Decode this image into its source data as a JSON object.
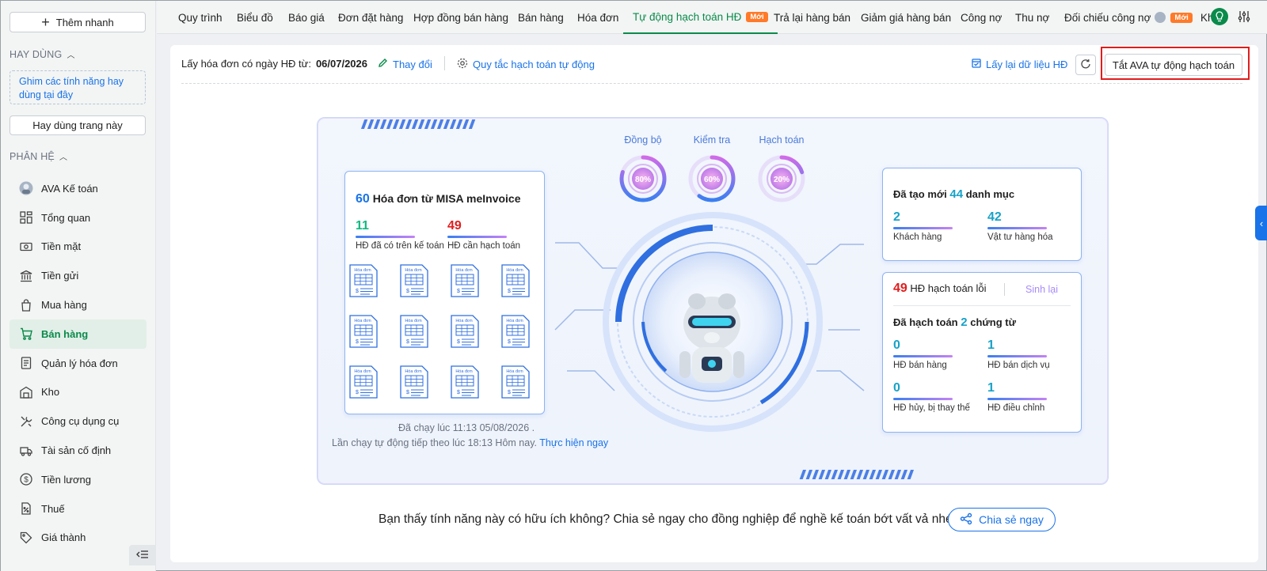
{
  "sidebar": {
    "quick_add": "Thêm nhanh",
    "favorites_title": "HAY DÙNG",
    "pin_hint": "Ghim các tính năng hay dùng tại đây",
    "fav_button": "Hay dùng trang này",
    "modules_title": "PHÂN HỆ",
    "items": [
      {
        "label": "AVA Kế toán",
        "icon": "ava-avatar-icon"
      },
      {
        "label": "Tổng quan",
        "icon": "dashboard-icon"
      },
      {
        "label": "Tiền mặt",
        "icon": "cash-icon"
      },
      {
        "label": "Tiền gửi",
        "icon": "bank-icon"
      },
      {
        "label": "Mua hàng",
        "icon": "shopping-bag-icon"
      },
      {
        "label": "Bán hàng",
        "icon": "cart-icon"
      },
      {
        "label": "Quản lý hóa đơn",
        "icon": "invoice-icon"
      },
      {
        "label": "Kho",
        "icon": "warehouse-icon"
      },
      {
        "label": "Công cụ dụng cụ",
        "icon": "tools-icon"
      },
      {
        "label": "Tài sản cố định",
        "icon": "truck-icon"
      },
      {
        "label": "Tiền lương",
        "icon": "dollar-circle-icon"
      },
      {
        "label": "Thuế",
        "icon": "tax-icon"
      },
      {
        "label": "Giá thành",
        "icon": "price-tag-icon"
      }
    ],
    "active_item": "Bán hàng"
  },
  "tabs": [
    {
      "label": "Quy trình"
    },
    {
      "label": "Biểu đồ"
    },
    {
      "label": "Báo giá"
    },
    {
      "label": "Đơn đặt hàng"
    },
    {
      "label": "Hợp đồng bán hàng"
    },
    {
      "label": "Bán hàng"
    },
    {
      "label": "Hóa đơn"
    },
    {
      "label": "Tự động hạch toán HĐ",
      "badge": "Mới"
    },
    {
      "label": "Trả lại hàng bán"
    },
    {
      "label": "Giảm giá hàng bán"
    },
    {
      "label": "Công nợ"
    },
    {
      "label": "Thu nợ"
    },
    {
      "label": "Đối chiếu công nợ",
      "badge": "Mới"
    },
    {
      "label": "Kh"
    }
  ],
  "toolbar": {
    "date_label": "Lấy hóa đơn có ngày HĐ từ:",
    "date_value": "06/07/2026",
    "change_label": "Thay đổi",
    "rules_label": "Quy tắc hạch toán tự động",
    "reload_label": "Lấy lại dữ liệu HĐ",
    "ava_toggle_label": "Tắt AVA tự động hạch toán"
  },
  "gauges": [
    {
      "label": "Đồng bộ",
      "value": "80%",
      "pct": 80
    },
    {
      "label": "Kiểm tra",
      "value": "60%",
      "pct": 60
    },
    {
      "label": "Hạch toán",
      "value": "20%",
      "pct": 20
    }
  ],
  "left_card": {
    "count": "60",
    "title": "Hóa đơn từ MISA meInvoice",
    "stat1_value": "11",
    "stat1_label": "HĐ đã có trên kế toán",
    "stat2_value": "49",
    "stat2_label": "HĐ cần hạch toán",
    "invoice_icon_label": "Hóa đơn"
  },
  "right_top": {
    "prefix": "Đã tạo mới",
    "count": "44",
    "suffix": "danh mục",
    "a_value": "2",
    "a_label": "Khách hàng",
    "b_value": "42",
    "b_label": "Vật tư hàng hóa"
  },
  "right_bottom": {
    "error_count": "49",
    "error_label": "HĐ hạch toán lỗi",
    "regen_label": "Sinh lại",
    "posted_prefix": "Đã hạch toán",
    "posted_count": "2",
    "posted_suffix": "chứng từ",
    "items": [
      {
        "value": "0",
        "label": "HĐ bán hàng"
      },
      {
        "value": "1",
        "label": "HĐ bán dịch vụ"
      },
      {
        "value": "0",
        "label": "HĐ hủy, bị thay thế"
      },
      {
        "value": "1",
        "label": "HĐ điều chỉnh"
      }
    ]
  },
  "run_info": {
    "last_run": "Đã chạy lúc 11:13 05/08/2026 .",
    "next_run": "Lần chạy tự động tiếp theo lúc 18:13 Hôm nay.",
    "run_now": "Thực hiện ngay"
  },
  "share": {
    "text": "Bạn thấy tính năng này có hữu ích không? Chia sẻ ngay cho đồng nghiệp để nghề kế toán bớt vất vả nhé!",
    "button": "Chia sẻ ngay"
  },
  "colors": {
    "accent_green": "#0a8a4b",
    "link_blue": "#1a73e8",
    "badge_orange": "#ff7a29",
    "error_red": "#e11d1d",
    "cyan": "#17a2c8"
  }
}
